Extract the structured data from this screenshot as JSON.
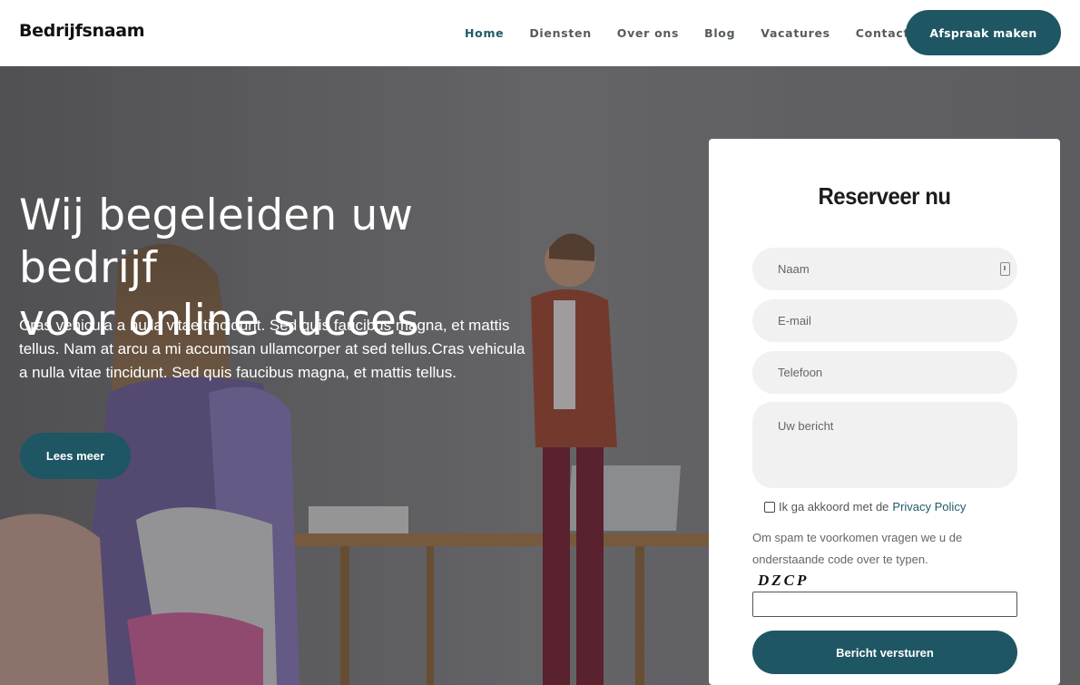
{
  "header": {
    "brand": "Bedrijfsnaam",
    "nav": [
      "Home",
      "Diensten",
      "Over ons",
      "Blog",
      "Vacatures",
      "Contact"
    ],
    "active_nav": "Home",
    "cta_label": "Afspraak maken"
  },
  "hero": {
    "title_line1": "Wij begeleiden uw bedrijf",
    "title_line2": "voor online succes",
    "text": "Cras vehicula a nulla vitae tincidunt. Sed quis faucibus magna, et mattis tellus. Nam at arcu a mi accumsan ullamcorper at sed tellus.Cras vehicula a nulla vitae tincidunt. Sed quis faucibus magna, et mattis tellus.",
    "button_label": "Lees meer"
  },
  "form": {
    "title": "Reserveer nu",
    "name_placeholder": "Naam",
    "email_placeholder": "E-mail",
    "phone_placeholder": "Telefoon",
    "message_placeholder": "Uw bericht",
    "consent_text": "Ik ga akkoord met de",
    "consent_link": "Privacy Policy",
    "spam_text": "Om spam te voorkomen vragen we u de onderstaande code over te typen.",
    "captcha_code": "DZCP",
    "submit_label": "Bericht versturen"
  },
  "icons": {
    "name_field": "contact-card-icon"
  },
  "colors": {
    "accent": "#1f5664",
    "nav_active": "#1f5a66",
    "nav_text": "#555b5f",
    "field_bg": "#f1f1f1"
  }
}
